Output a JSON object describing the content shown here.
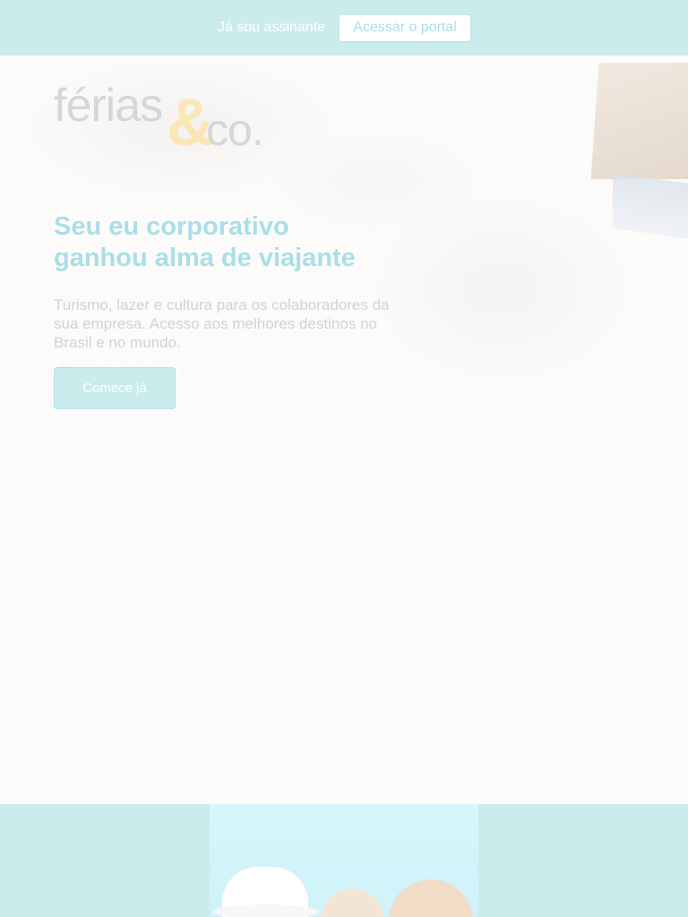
{
  "topbar": {
    "text": "Já sou assinante",
    "button_label": "Acessar o portal"
  },
  "logo": {
    "part1": "férias",
    "ampersand": "&",
    "part2": "co."
  },
  "hero": {
    "headline_line1": "Seu eu corporativo",
    "headline_line2": "ganhou alma de viajante",
    "description": "Turismo, lazer e cultura para os colaboradores da sua empresa. Acesso aos melhores destinos no Brasil e no mundo.",
    "ghost_text": "Comece já",
    "cta_label": "Comece já"
  },
  "colors": {
    "accent": "#cbeced",
    "headline": "#a9dfe6",
    "logo_amp": "#fbe6b5",
    "hero_bg": "#fcfbfa"
  }
}
